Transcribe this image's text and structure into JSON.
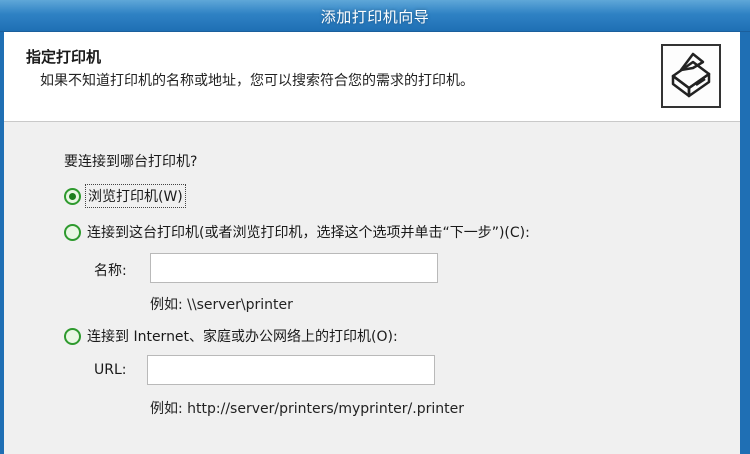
{
  "window": {
    "title": "添加打印机向导"
  },
  "header": {
    "title": "指定打印机",
    "subtitle": "如果不知道打印机的名称或地址，您可以搜索符合您的需求的打印机。",
    "icon": "printer-icon"
  },
  "body": {
    "question": "要连接到哪台打印机?",
    "options": [
      {
        "label": "浏览打印机(W)",
        "checked": true
      },
      {
        "label": "连接到这台打印机(或者浏览打印机，选择这个选项并单击“下一步”)(C):",
        "checked": false
      },
      {
        "label": "连接到 Internet、家庭或办公网络上的打印机(O):",
        "checked": false
      }
    ],
    "name_field": {
      "label": "名称:",
      "value": "",
      "example": "例如: \\\\server\\printer"
    },
    "url_field": {
      "label": "URL:",
      "value": "",
      "example": "例如: http://server/printers/myprinter/.printer"
    }
  },
  "colors": {
    "titlebar": "#2f82c4",
    "radio_border": "#2e9a2e",
    "frame": "#1f6fb4"
  }
}
